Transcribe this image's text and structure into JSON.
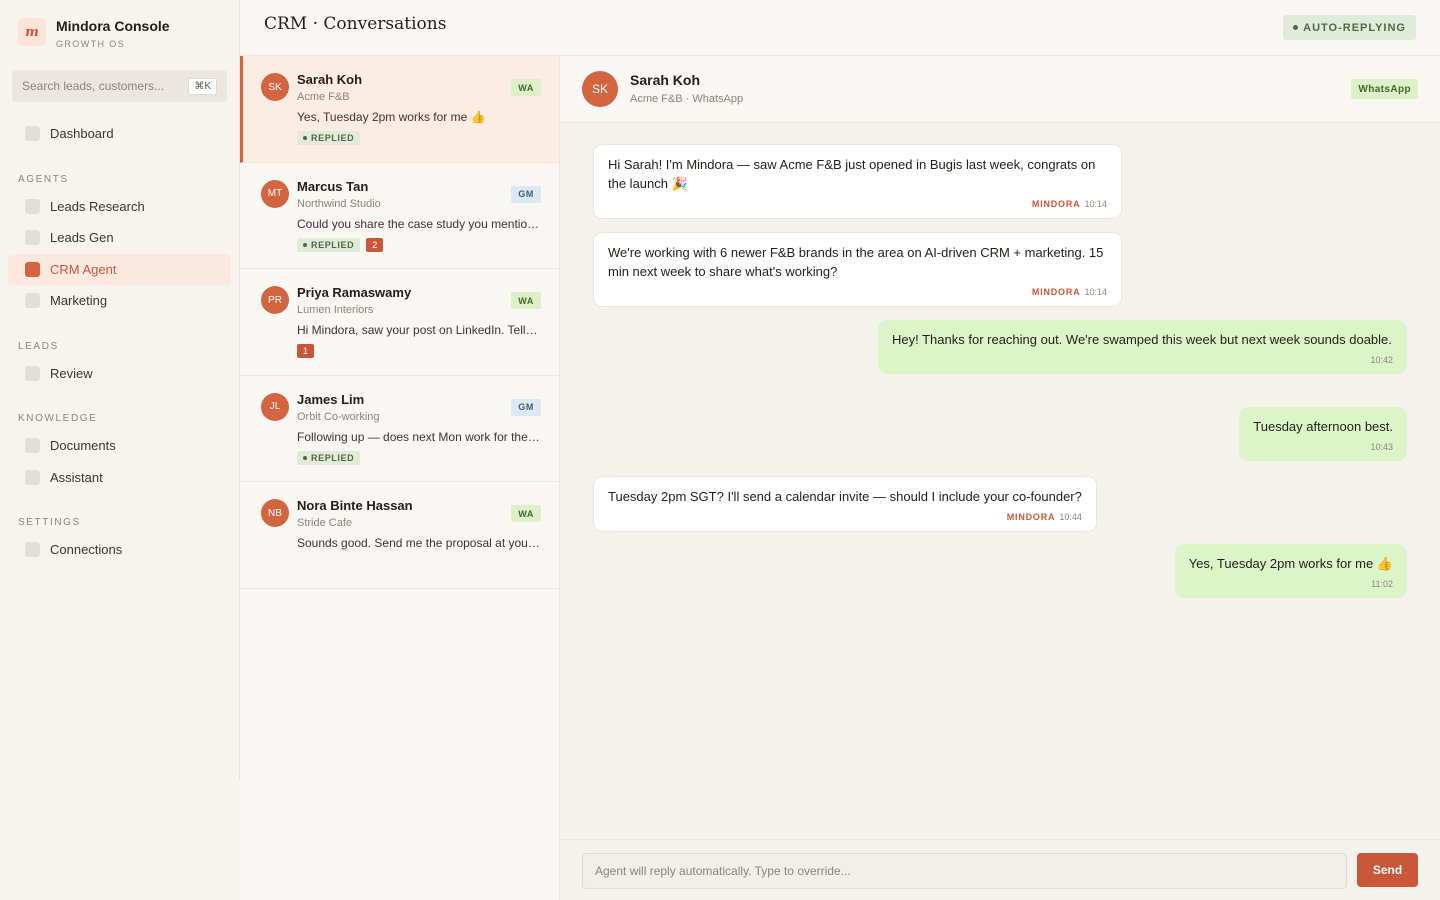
{
  "app": {
    "logo_letter": "m",
    "name": "Mindora Console",
    "subtitle": "GROWTH OS"
  },
  "search": {
    "placeholder": "Search leads, customers...",
    "shortcut": "⌘K"
  },
  "nav": {
    "dashboard": "Dashboard",
    "agents_title": "AGENTS",
    "leads_research": "Leads Research",
    "leads_gen": "Leads Gen",
    "crm_agent": "CRM Agent",
    "marketing": "Marketing",
    "leads_title": "LEADS",
    "review": "Review",
    "knowledge_title": "KNOWLEDGE",
    "documents": "Documents",
    "assistant": "Assistant",
    "settings_title": "SETTINGS",
    "connections": "Connections",
    "active_item": "CRM Agent"
  },
  "header": {
    "title": "CRM · Conversations",
    "status": "AUTO-REPLYING"
  },
  "conversations": [
    {
      "initials": "SK",
      "name": "Sarah Koh",
      "company": "Acme F&B",
      "channel": "WA",
      "preview": "Yes, Tuesday 2pm works for me 👍",
      "replied": "REPLIED",
      "count": ""
    },
    {
      "initials": "MT",
      "name": "Marcus Tan",
      "company": "Northwind Studio",
      "channel": "GM",
      "preview": "Could you share the case study you mentioned?",
      "replied": "REPLIED",
      "count": "2"
    },
    {
      "initials": "PR",
      "name": "Priya Ramaswamy",
      "company": "Lumen Interiors",
      "channel": "WA",
      "preview": "Hi Mindora, saw your post on LinkedIn. Tell me more",
      "replied": "",
      "count": "1"
    },
    {
      "initials": "JL",
      "name": "James Lim",
      "company": "Orbit Co-working",
      "channel": "GM",
      "preview": "Following up — does next Mon work for the call?",
      "replied": "REPLIED",
      "count": ""
    },
    {
      "initials": "NB",
      "name": "Nora Binte Hassan",
      "company": "Stride Cafe",
      "channel": "WA",
      "preview": "Sounds good. Send me the proposal at your convenience",
      "replied": "",
      "count": ""
    }
  ],
  "chat": {
    "initials": "SK",
    "name": "Sarah Koh",
    "subtitle": "Acme F&B · WhatsApp",
    "channel": "WhatsApp",
    "messages": [
      {
        "direction": "in",
        "sender": "MINDORA",
        "time": "10:14",
        "text": "Hi Sarah! I'm Mindora — saw Acme F&B just opened in Bugis last week, congrats on the launch 🎉"
      },
      {
        "direction": "in",
        "sender": "MINDORA",
        "time": "10:14",
        "text": "We're working with 6 newer F&B brands in the area on AI-driven CRM + marketing. 15 min next week to share what's working?"
      },
      {
        "direction": "out",
        "sender": "",
        "time": "10:42",
        "text": "Hey! Thanks for reaching out. We're swamped this week but next week sounds doable."
      },
      {
        "direction": "out",
        "sender": "",
        "time": "10:43",
        "text": "Tuesday afternoon best."
      },
      {
        "direction": "in",
        "sender": "MINDORA",
        "time": "10:44",
        "text": "Tuesday 2pm SGT? I'll send a calendar invite — should I include your co-founder?"
      },
      {
        "direction": "out",
        "sender": "",
        "time": "11:02",
        "text": "Yes, Tuesday 2pm works for me 👍"
      }
    ]
  },
  "composer": {
    "placeholder": "Agent will reply automatically. Type to override...",
    "send_label": "Send"
  },
  "colors": {
    "accent": "#c9573a",
    "accent_light": "#fbe8de",
    "outgoing_bubble": "#dcf5c8",
    "status_green": "#4f6a3e"
  }
}
